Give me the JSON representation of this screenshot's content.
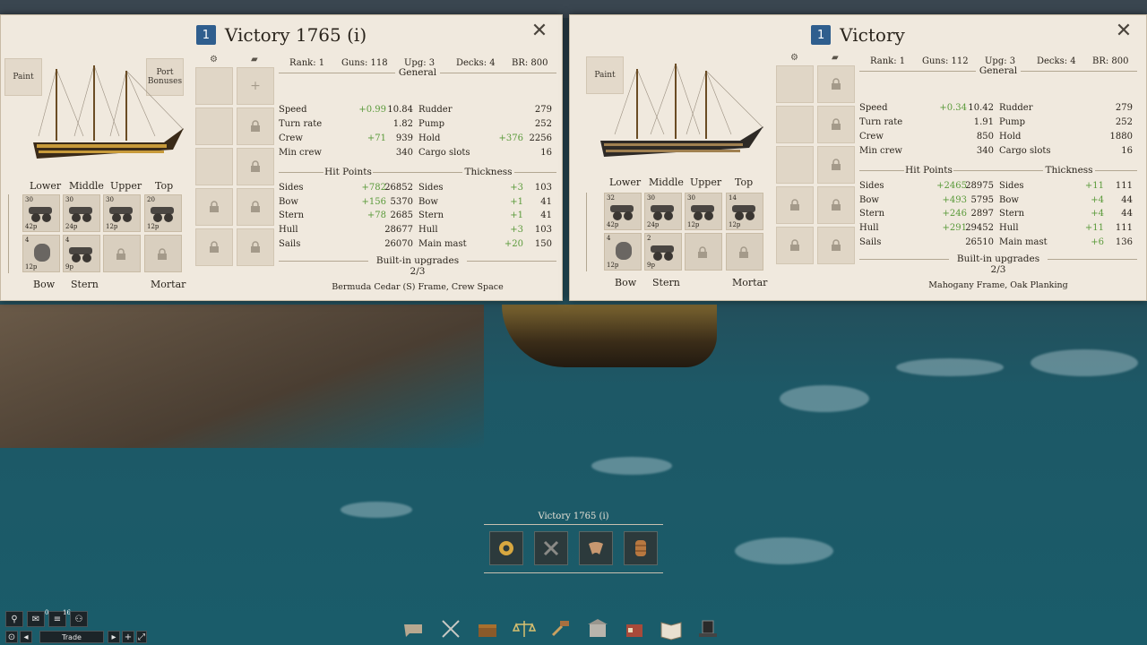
{
  "colors": {
    "panel_bg": "#f0e9de",
    "rank_blue": "#2f5e8e",
    "positive": "#5a9a3a",
    "sea": "#1d5866"
  },
  "left": {
    "rank_badge": "1",
    "title": "Victory 1765 (i)",
    "paint": "Paint",
    "port_bonuses": "Port\nBonuses",
    "summary": [
      "Rank: 1",
      "Guns: 118",
      "Upg: 3",
      "Decks: 4",
      "BR: 800"
    ],
    "decks": [
      "Lower",
      "Middle",
      "Upper",
      "Top"
    ],
    "guns_row1": [
      {
        "n": "30",
        "c": "42p"
      },
      {
        "n": "30",
        "c": "24p"
      },
      {
        "n": "30",
        "c": "12p"
      },
      {
        "n": "20",
        "c": "12p"
      }
    ],
    "guns_row2": [
      {
        "n": "4",
        "c": "12p",
        "type": "carronade"
      },
      {
        "n": "4",
        "c": "9p",
        "type": "cannon"
      }
    ],
    "bottom_labels": {
      "bow": "Bow",
      "stern": "Stern",
      "mortar": "Mortar"
    },
    "general": "General",
    "general_rows": [
      {
        "l": "Speed",
        "d": "+0.99",
        "v": "10.84",
        "l2": "Rudder",
        "d2": "",
        "v2": "279"
      },
      {
        "l": "Turn rate",
        "d": "",
        "v": "1.82",
        "l2": "Pump",
        "d2": "",
        "v2": "252"
      },
      {
        "l": "Crew",
        "d": "+71",
        "v": "939",
        "l2": "Hold",
        "d2": "+376",
        "v2": "2256"
      },
      {
        "l": "Min crew",
        "d": "",
        "v": "340",
        "l2": "Cargo slots",
        "d2": "",
        "v2": "16"
      }
    ],
    "hp": "Hit Points",
    "thickness": "Thickness",
    "hp_rows": [
      {
        "l": "Sides",
        "d": "+782",
        "v": "26852",
        "l2": "Sides",
        "d2": "+3",
        "v2": "103"
      },
      {
        "l": "Bow",
        "d": "+156",
        "v": "5370",
        "l2": "Bow",
        "d2": "+1",
        "v2": "41"
      },
      {
        "l": "Stern",
        "d": "+78",
        "v": "2685",
        "l2": "Stern",
        "d2": "+1",
        "v2": "41"
      },
      {
        "l": "Hull",
        "d": "",
        "v": "28677",
        "l2": "Hull",
        "d2": "+3",
        "v2": "103"
      },
      {
        "l": "Sails",
        "d": "",
        "v": "26070",
        "l2": "Main mast",
        "d2": "+20",
        "v2": "150"
      }
    ],
    "builtin": "Built-in upgrades 2/3",
    "upgrades": "Bermuda Cedar (S) Frame, Crew Space"
  },
  "right": {
    "rank_badge": "1",
    "title": "Victory",
    "paint": "Paint",
    "summary": [
      "Rank: 1",
      "Guns: 112",
      "Upg: 3",
      "Decks: 4",
      "BR: 800"
    ],
    "decks": [
      "Lower",
      "Middle",
      "Upper",
      "Top"
    ],
    "guns_row1": [
      {
        "n": "32",
        "c": "42p"
      },
      {
        "n": "30",
        "c": "24p"
      },
      {
        "n": "30",
        "c": "12p"
      },
      {
        "n": "14",
        "c": "12p"
      }
    ],
    "guns_row2": [
      {
        "n": "4",
        "c": "12p",
        "type": "carronade"
      },
      {
        "n": "2",
        "c": "9p",
        "type": "cannon"
      }
    ],
    "bottom_labels": {
      "bow": "Bow",
      "stern": "Stern",
      "mortar": "Mortar"
    },
    "general": "General",
    "general_rows": [
      {
        "l": "Speed",
        "d": "+0.34",
        "v": "10.42",
        "l2": "Rudder",
        "d2": "",
        "v2": "279"
      },
      {
        "l": "Turn rate",
        "d": "",
        "v": "1.91",
        "l2": "Pump",
        "d2": "",
        "v2": "252"
      },
      {
        "l": "Crew",
        "d": "",
        "v": "850",
        "l2": "Hold",
        "d2": "",
        "v2": "1880"
      },
      {
        "l": "Min crew",
        "d": "",
        "v": "340",
        "l2": "Cargo slots",
        "d2": "",
        "v2": "16"
      }
    ],
    "hp": "Hit Points",
    "thickness": "Thickness",
    "hp_rows": [
      {
        "l": "Sides",
        "d": "+2465",
        "v": "28975",
        "l2": "Sides",
        "d2": "+11",
        "v2": "111"
      },
      {
        "l": "Bow",
        "d": "+493",
        "v": "5795",
        "l2": "Bow",
        "d2": "+4",
        "v2": "44"
      },
      {
        "l": "Stern",
        "d": "+246",
        "v": "2897",
        "l2": "Stern",
        "d2": "+4",
        "v2": "44"
      },
      {
        "l": "Hull",
        "d": "+291",
        "v": "29452",
        "l2": "Hull",
        "d2": "+11",
        "v2": "111"
      },
      {
        "l": "Sails",
        "d": "",
        "v": "26510",
        "l2": "Main mast",
        "d2": "+6",
        "v2": "136"
      }
    ],
    "builtin": "Built-in upgrades 2/3",
    "upgrades": "Mahogany Frame, Oak Planking"
  },
  "hud": {
    "ship_label": "Victory 1765 (i)",
    "buttons": [
      "gear-icon",
      "hammer-icon",
      "sail-icon",
      "barrel-icon"
    ]
  },
  "corner": {
    "mail_count": "0",
    "list_count": "16",
    "trade": "Trade"
  },
  "bottombar": [
    "chat-icon",
    "crossed-swords-icon",
    "chest-icon",
    "scales-icon",
    "auction-icon",
    "building-icon",
    "shop-icon",
    "book-icon",
    "tophat-icon"
  ]
}
